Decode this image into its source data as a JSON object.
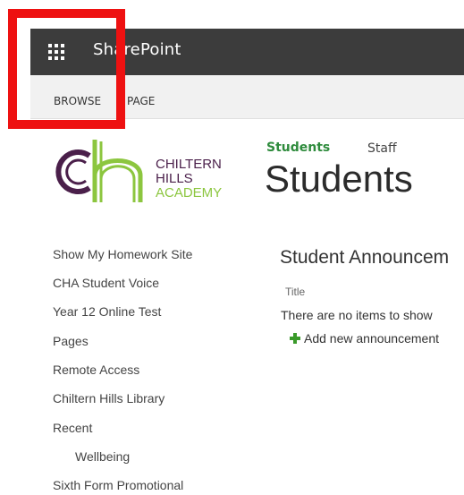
{
  "suite_bar": {
    "app_title": "SharePoint",
    "launcher_icon": "app-launcher-waffle-icon",
    "background": "#3c3c3c"
  },
  "ribbon": {
    "tabs": [
      {
        "label": "BROWSE"
      },
      {
        "label": "PAGE"
      }
    ]
  },
  "highlight": {
    "color": "#ee1111"
  },
  "logo": {
    "line1": "CHILTERN",
    "line2": "HILLS",
    "line3": "ACADEMY",
    "brand_purple": "#4a1f4a",
    "brand_green": "#8cc63f"
  },
  "top_nav": {
    "items": [
      {
        "label": "Students",
        "selected": true
      },
      {
        "label": "Staff",
        "selected": false
      }
    ]
  },
  "page_title": "Students",
  "left_nav": {
    "items": [
      {
        "label": "Show My Homework Site"
      },
      {
        "label": "CHA Student Voice"
      },
      {
        "label": "Year 12 Online Test"
      },
      {
        "label": "Pages"
      },
      {
        "label": "Remote Access"
      },
      {
        "label": "Chiltern Hills Library"
      },
      {
        "label": "Recent"
      },
      {
        "label": "Wellbeing"
      },
      {
        "label": "Sixth Form Promotional"
      }
    ]
  },
  "web_part": {
    "title": "Student Announcem",
    "column_header": "Title",
    "empty_message": "There are no items to show",
    "add_link": "Add new announcement"
  }
}
